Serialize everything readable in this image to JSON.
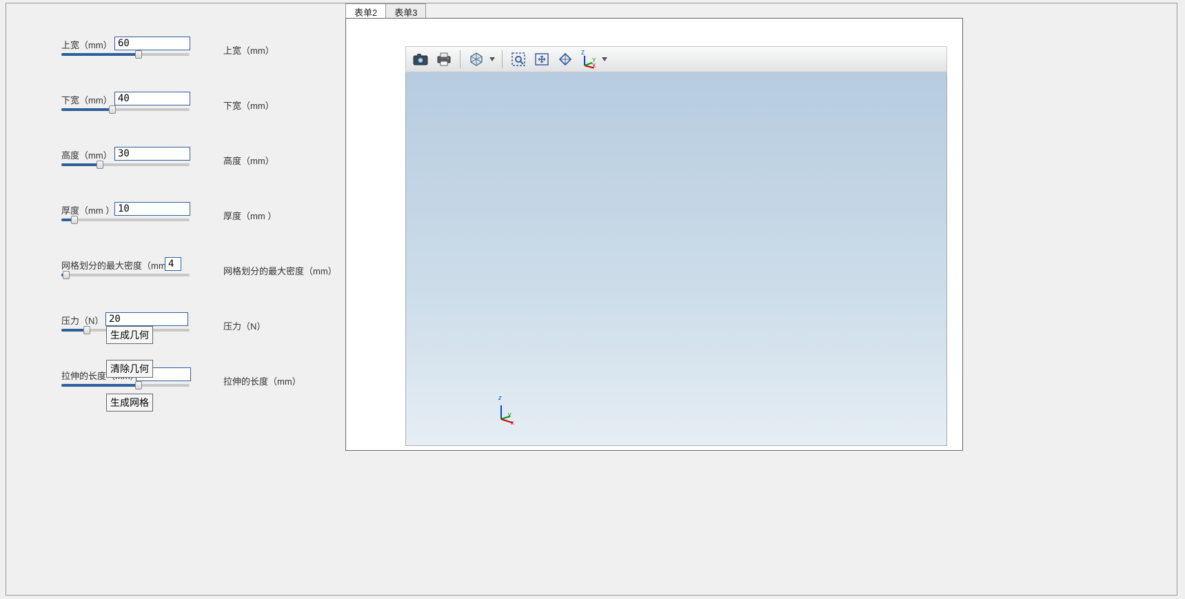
{
  "tabs": [
    {
      "label": "表单2",
      "active": true
    },
    {
      "label": "表单3",
      "active": false
    }
  ],
  "params": {
    "sw": {
      "left_label": "上宽（mm）",
      "value": "60",
      "slider_pct": 60,
      "right_label": "上宽（mm）"
    },
    "xw": {
      "left_label": "下宽（mm）",
      "value": "40",
      "slider_pct": 40,
      "right_label": "下宽（mm）"
    },
    "gd": {
      "left_label": "高度（mm）",
      "value": "30",
      "slider_pct": 30,
      "right_label": "高度（mm）"
    },
    "hd": {
      "left_label": "厚度（mm ）",
      "value": "10",
      "slider_pct": 10,
      "right_label": "厚度（mm ）"
    },
    "mesh": {
      "left_label": "网格划分的最大密度（mm）",
      "value": "4",
      "slider_pct": 4,
      "right_label": "网格划分的最大密度（mm）"
    },
    "yl": {
      "left_label": "压力（N）",
      "value": "20",
      "slider_pct": 20,
      "right_label": "压力（N）"
    },
    "ls": {
      "left_label": "拉伸的长度（mm）",
      "value": "60",
      "slider_pct": 60,
      "right_label": "拉伸的长度（mm）"
    }
  },
  "buttons": {
    "gen_geom": "生成几何",
    "clear_geom": "清除几何",
    "gen_mesh": "生成网格"
  },
  "toolbar": {
    "camera": "camera-icon",
    "print": "print-icon",
    "transparency": "transparency-icon",
    "zoom_box": "zoom-box-icon",
    "zoom_extents": "zoom-extents-icon",
    "reset_view": "reset-view-icon",
    "axis_view": "axis-view-icon"
  },
  "axis": {
    "z": "z",
    "y": "y",
    "x": "x"
  }
}
